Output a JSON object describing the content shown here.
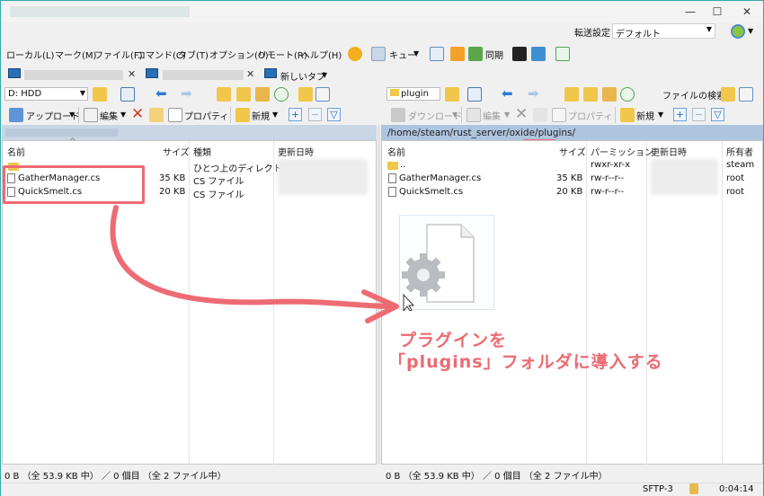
{
  "window": {
    "controls": [
      "—",
      "☐",
      "✕"
    ]
  },
  "transfer_settings": {
    "label": "転送設定",
    "value": "デフォルト"
  },
  "menu": {
    "items": [
      "ローカル(L)",
      "マーク(M)",
      "ファイル(F)",
      "コマンド(C)",
      "タブ(T)",
      "オプション(O)",
      "リモート(R)",
      "ヘルプ(H)"
    ],
    "queue": "キュー",
    "sync": "同期"
  },
  "tabs": {
    "new_tab": "新しいタブ"
  },
  "left": {
    "drive": "D: HDD",
    "upload": "アップロード",
    "edit": "編集",
    "properties": "プロパティ",
    "new": "新規",
    "columns": [
      "名前",
      "サイズ",
      "種類",
      "更新日時"
    ],
    "parent_label": "ひとつ上のディレクトリ",
    "files": [
      {
        "name": "GatherManager.cs",
        "size": "35 KB",
        "type": "CS ファイル"
      },
      {
        "name": "QuickSmelt.cs",
        "size": "20 KB",
        "type": "CS ファイル"
      }
    ],
    "status": "0 B （全 53.9 KB 中） ／ 0 個目 （全 2 ファイル中）"
  },
  "right": {
    "folder": "plugin",
    "find_files": "ファイルの検索",
    "download": "ダウンロード",
    "edit": "編集",
    "properties": "プロパティ",
    "new": "新規",
    "path": "/home/steam/rust_server/oxide/plugins/",
    "columns": [
      "名前",
      "サイズ",
      "パーミッション",
      "更新日時",
      "所有者"
    ],
    "parent": {
      "name": "..",
      "perm": "rwxr-xr-x",
      "owner": "steam"
    },
    "files": [
      {
        "name": "GatherManager.cs",
        "size": "35 KB",
        "perm": "rw-r--r--",
        "owner": "root"
      },
      {
        "name": "QuickSmelt.cs",
        "size": "20 KB",
        "perm": "rw-r--r--",
        "owner": "root"
      }
    ],
    "status": "0 B （全 53.9 KB 中） ／ 0 個目 （全 2 ファイル中）",
    "protocol": "SFTP-3",
    "time": "0:04:14"
  },
  "annotation": {
    "line1": "プラグインを",
    "line2": "「plugins」フォルダに導入する",
    "color": "#ec6b73"
  }
}
